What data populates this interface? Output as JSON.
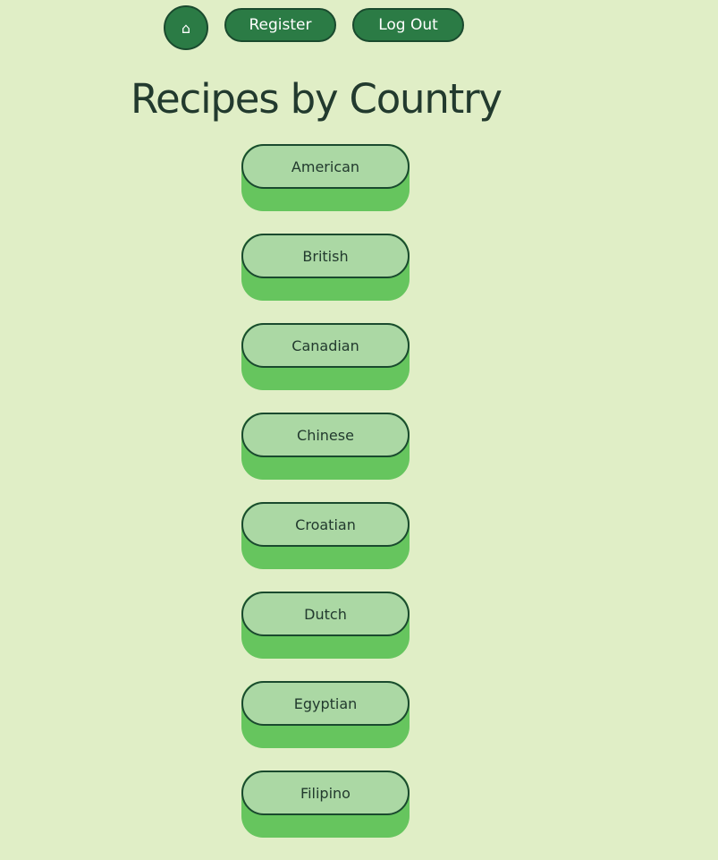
{
  "nav": {
    "home_label": "⌂",
    "register_label": "Register",
    "logout_label": "Log Out"
  },
  "page": {
    "title": "Recipes by Country"
  },
  "countries": [
    {
      "label": "American"
    },
    {
      "label": "British"
    },
    {
      "label": "Canadian"
    },
    {
      "label": "Chinese"
    },
    {
      "label": "Croatian"
    },
    {
      "label": "Dutch"
    },
    {
      "label": "Egyptian"
    },
    {
      "label": "Filipino"
    }
  ],
  "colors": {
    "background": "#e0eec6",
    "nav_button": "#2b7b45",
    "country_face": "#abd8a4",
    "country_shadow": "#66c55e",
    "text_dark": "#223a2e"
  }
}
